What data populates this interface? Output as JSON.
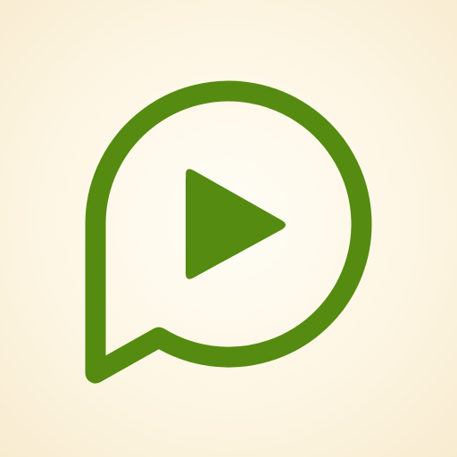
{
  "icon": {
    "name": "play-chat-bubble-icon",
    "stroke_color": "#558b10",
    "fill_color": "#558b10",
    "background_center": "#fffdf6",
    "background_edge": "#f8ecd0"
  }
}
